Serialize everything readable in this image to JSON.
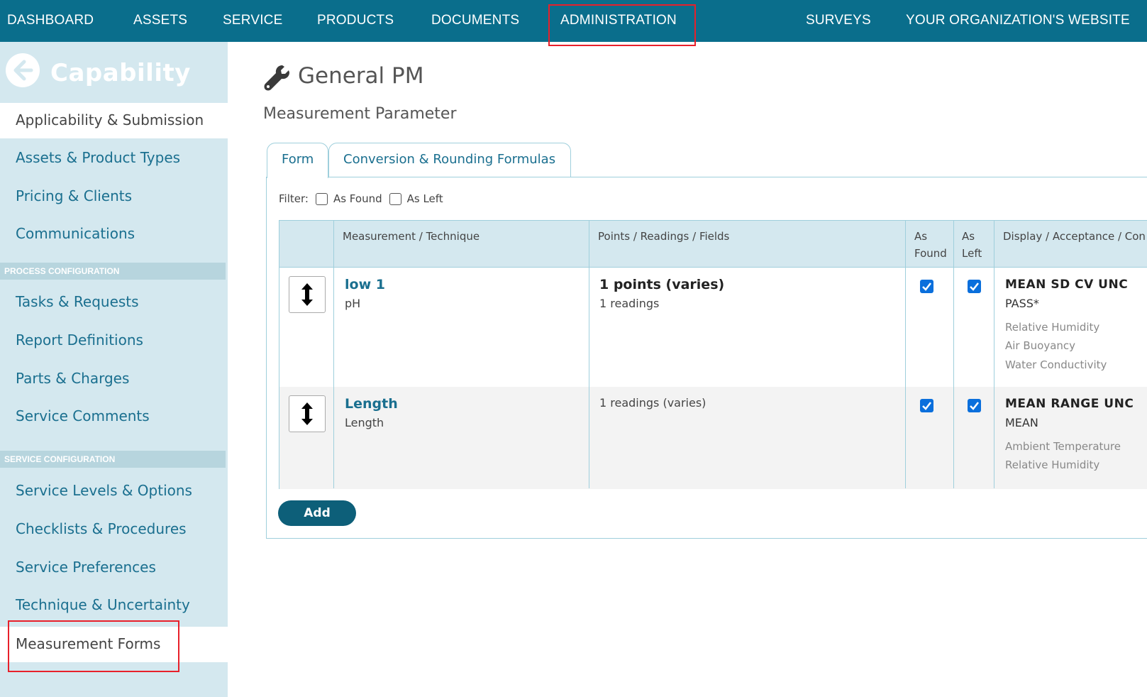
{
  "topnav": {
    "items": [
      "DASHBOARD",
      "ASSETS",
      "SERVICE",
      "PRODUCTS",
      "DOCUMENTS",
      "ADMINISTRATION",
      "SURVEYS",
      "YOUR ORGANIZATION'S WEBSITE"
    ],
    "highlighted": "ADMINISTRATION",
    "bg_color": "#0a6e8c"
  },
  "sidebar": {
    "title": "Capability",
    "back_icon": "arrow-left-circle-icon",
    "items": [
      "Applicability & Submission",
      "Assets & Product Types",
      "Pricing & Clients",
      "Communications"
    ],
    "section_process": "PROCESS CONFIGURATION",
    "process_items": [
      "Tasks & Requests",
      "Report Definitions",
      "Parts & Charges",
      "Service Comments"
    ],
    "section_service": "SERVICE CONFIGURATION",
    "service_items": [
      "Service Levels & Options",
      "Checklists & Procedures",
      "Service Preferences",
      "Technique & Uncertainty",
      "Measurement Forms"
    ],
    "active_item": "Applicability & Submission",
    "highlighted_item": "Measurement Forms"
  },
  "main": {
    "title": "General PM",
    "title_icon": "wrench-icon",
    "subtitle": "Measurement Parameter",
    "tabs": [
      {
        "label": "Form",
        "active": true
      },
      {
        "label": "Conversion & Rounding Formulas",
        "active": false
      }
    ],
    "filter": {
      "label": "Filter:",
      "options": [
        {
          "label": "As Found",
          "checked": false
        },
        {
          "label": "As Left",
          "checked": false
        }
      ]
    },
    "table": {
      "headers": {
        "measurement": "Measurement / Technique",
        "points": "Points / Readings / Fields",
        "as_found_1": "As",
        "as_found_2": "Found",
        "as_left_1": "As",
        "as_left_2": "Left",
        "display": "Display / Acceptance / Con"
      },
      "rows": [
        {
          "name": "low 1",
          "technique": "pH",
          "points": "1 points (varies)",
          "readings": "1 readings",
          "as_found": true,
          "as_left": true,
          "display": "MEAN  SD  CV  UNC",
          "acceptance": "PASS*",
          "conditions": [
            "Relative Humidity",
            "Air Buoyancy",
            "Water Conductivity"
          ]
        },
        {
          "name": "Length",
          "technique": "Length",
          "points": "",
          "readings": "1 readings (varies)",
          "as_found": true,
          "as_left": true,
          "display": "MEAN  RANGE  UNC",
          "acceptance": "MEAN",
          "conditions": [
            "Ambient Temperature",
            "Relative Humidity"
          ]
        }
      ]
    },
    "add_label": "Add"
  }
}
